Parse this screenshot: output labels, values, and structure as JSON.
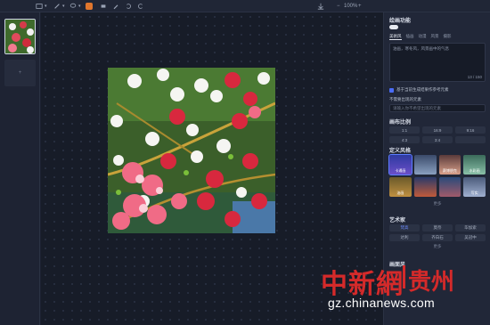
{
  "toolbar": {
    "zoom": "100%",
    "minus": "−",
    "plus": "+",
    "icons": [
      "select-icon",
      "brush-icon",
      "lasso-icon",
      "generate-icon",
      "eraser-icon",
      "pen-icon",
      "undo-icon",
      "redo-icon",
      "download-icon"
    ]
  },
  "left": {
    "add_label": "+"
  },
  "panel": {
    "title": "绘画功能",
    "tabs": [
      "美術风",
      "插画",
      "动漫",
      "风景",
      "摄影"
    ],
    "prompt_text": "油画，寒冬风，风景画中的气息",
    "counter": "13 / 150",
    "checkbox_label": "基于当前生成结果作参考元素",
    "ref_title": "不需要出现的元素",
    "ref_placeholder": "请输入你不希望出现的元素",
    "ratio_title": "画布比例",
    "ratios": [
      "1:1",
      "16:9",
      "9:16",
      "4:3",
      "3:4",
      ""
    ],
    "style_title": "定义风格",
    "styles": [
      "卡通画",
      "",
      "赛博朋克",
      "水彩画",
      "油画",
      "",
      "",
      "写实"
    ],
    "style_more": "更多",
    "artist_title": "艺术家",
    "artists": [
      "梵高",
      "莫奈",
      "毕加索",
      "达利",
      "齐白石",
      "吴冠中"
    ],
    "artist_more": "更多",
    "mode_title": "画面风"
  },
  "watermark": {
    "brand": "中新網",
    "region": "贵州",
    "url": "gz.chinanews.com"
  },
  "colors": {
    "accent": "#e0762d",
    "selection": "#4a6cf7",
    "watermark": "#d42a2a"
  }
}
